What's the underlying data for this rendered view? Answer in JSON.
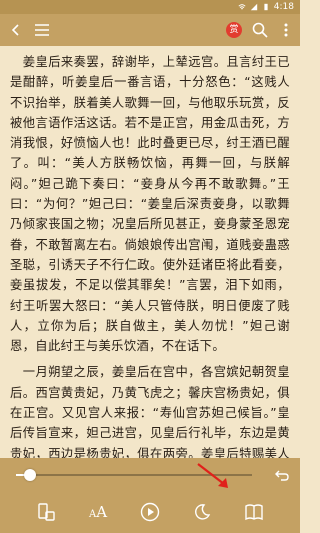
{
  "status_bar": {
    "time": "4:18"
  },
  "top_bar": {
    "reward_label": "赏",
    "icons": [
      "back-icon",
      "menu-icon",
      "search-icon",
      "more-icon"
    ]
  },
  "content": {
    "paragraphs": [
      "　姜皇后来奏罢，辞谢毕，上辇远宫。且言纣王已是酣醉，听姜皇后一番言语，十分怒色：“这贱人不识抬举，朕着美人歌舞一回，与他取乐玩赏，反被他言语作活这话。若不是正宫，用金瓜击死，方消我恨，好愤恼人也！此时叠更已尽，纣王酒已醒了。叫：“美人方朕畅饮恼，再舞一回，与朕解闷。”妲己跪下奏曰：“妾身从今再不敢歌舞。”王曰：“为何？”妲己曰：“姜皇后深责妾身，以歌舞乃倾家丧国之物；况皇后所见甚正，妾身蒙圣恩宠眷，不敢暂离左右。倘娘娘传出宫闱，道贱妾蛊惑圣聪，引诱天子不行仁政。使外廷诸臣将此看妾，妾虽拔发，不足以偿其罪矣！”言罢，泪下如雨，纣王听罢大怒曰：“美人只管侍朕，明日便废了贱人，立你为后；朕自做主，美人勿忧！”妲己谢恩，自此纣王与美乐饮酒，不在话下。",
      "　一月朔望之辰，姜皇后在宫中，各宫嫔妃朝贺皇后。西宫黄贵妃，乃黄飞虎之；馨庆宫杨贵妃，俱在正宫。又见宫人来报：“寿仙宫苏妲己候旨。”皇后传旨宣来，妲己进宫，见皇后行礼毕，东边是黄贵妃，西边是杨贵妃，俱在两旁。姜皇后特赐美人平身，妲己立于侧。二贵妃问曰：“这就是苏美人？”姜后曰：“正是。”因对苏氏责曰：“天子在寿仙宫，无分昼夜，宣淫作乐，不理朝"
    ]
  },
  "reading_progress": {
    "fraction": 0.06
  },
  "bottom_bar": {
    "font_label_large": "A",
    "font_label_small": "A",
    "icons": [
      "phone-rotate-icon",
      "font-size-icon",
      "play-icon",
      "night-mode-icon",
      "bookshelf-icon"
    ]
  },
  "colors": {
    "bar_bg": "#c4a163",
    "page_bg": "#f3e6c9",
    "text": "#2a2017",
    "reward_badge": "#e23c2f",
    "annotation_arrow": "#e0211b"
  }
}
